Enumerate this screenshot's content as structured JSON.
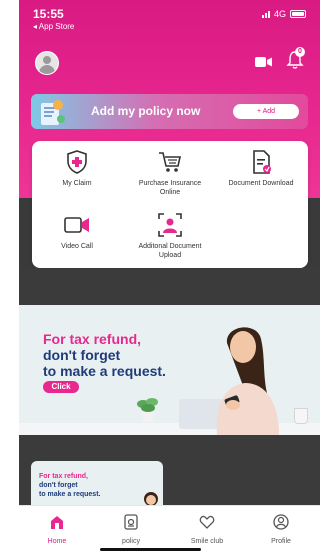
{
  "status_bar": {
    "time": "15:55",
    "back_label": "◂ App Store",
    "network": "4G"
  },
  "header": {
    "policy_banner": {
      "title": "Add my policy now",
      "button": "+ Add"
    },
    "notification_count": "0"
  },
  "quick_menu": {
    "items": [
      {
        "label": "My Claim",
        "icon": "shield-plus-icon"
      },
      {
        "label": "Purchase Insurance Online",
        "icon": "shopping-cart-icon"
      },
      {
        "label": "Document Download",
        "icon": "document-download-icon"
      },
      {
        "label": "Video Call",
        "icon": "video-call-icon"
      },
      {
        "label": "Additonal Document Upload",
        "icon": "upload-person-icon"
      }
    ]
  },
  "tax_banner": {
    "line1": "For tax refund,",
    "line2": "don't forget",
    "line3": "to make a request.",
    "cta": "Click"
  },
  "small_card": {
    "line1": "For tax refund,",
    "line2": "don't forget",
    "line3": "to make a request."
  },
  "bottom_nav": {
    "items": [
      {
        "label": "Home",
        "icon": "home-icon",
        "active": true
      },
      {
        "label": "policy",
        "icon": "policy-icon",
        "active": false
      },
      {
        "label": "Smile club",
        "icon": "heart-icon",
        "active": false
      },
      {
        "label": "Profile",
        "icon": "profile-icon",
        "active": false
      }
    ]
  },
  "colors": {
    "brand": "#d91a83",
    "accent_blue": "#1f3c7a"
  }
}
